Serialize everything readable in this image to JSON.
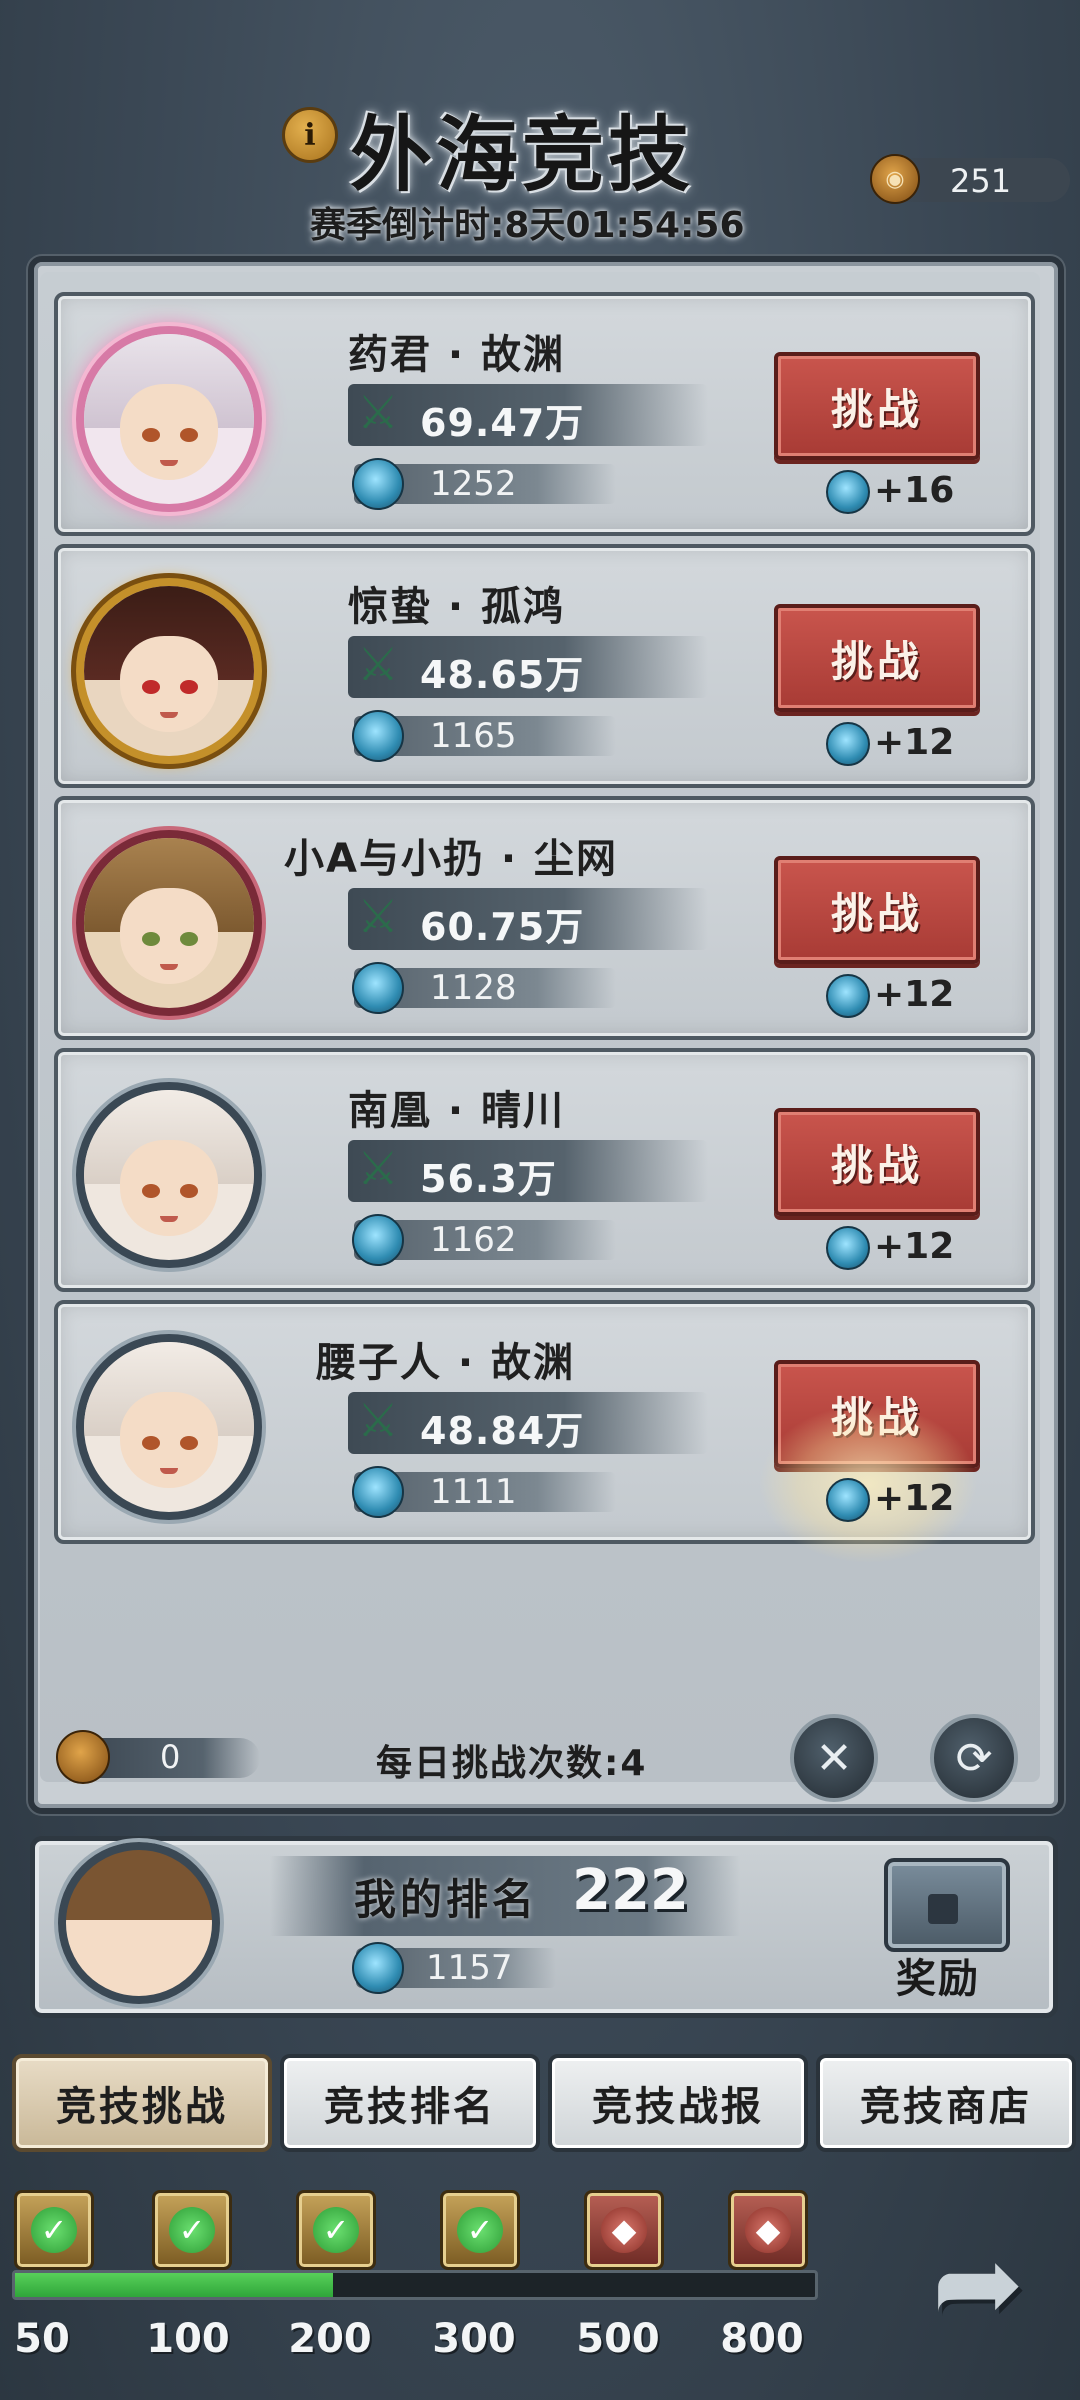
{
  "header": {
    "title": "外海竞技",
    "countdown": "赛季倒计时:8天01:54:56",
    "currency_value": "251",
    "info_icon": "info-icon",
    "currency_icon": "token-icon"
  },
  "opponents": [
    {
      "name": "药君 · 故渊",
      "power": "69.47万",
      "score": "1252",
      "gain": "+16",
      "button": "挑战"
    },
    {
      "name": "惊蛰 · 孤鸿",
      "power": "48.65万",
      "score": "1165",
      "gain": "+12",
      "button": "挑战"
    },
    {
      "name": "小A与小扔 · 尘网",
      "power": "60.75万",
      "score": "1128",
      "gain": "+12",
      "button": "挑战"
    },
    {
      "name": "南凰 · 晴川",
      "power": "56.3万",
      "score": "1162",
      "gain": "+12",
      "button": "挑战"
    },
    {
      "name": "腰子人 · 故渊",
      "power": "48.84万",
      "score": "1111",
      "gain": "+12",
      "button": "挑战"
    }
  ],
  "board_footer": {
    "ticket_value": "0",
    "daily_challenges": "每日挑战次数:4"
  },
  "my_rank": {
    "label": "我的排名",
    "rank": "222",
    "score": "1157",
    "reward_label": "奖励"
  },
  "tabs": [
    {
      "label": "竞技挑战",
      "active": true
    },
    {
      "label": "竞技排名",
      "active": false
    },
    {
      "label": "竞技战报",
      "active": false
    },
    {
      "label": "竞技商店",
      "active": false
    }
  ],
  "milestones": [
    {
      "label": "50",
      "claimed": true
    },
    {
      "label": "100",
      "claimed": true
    },
    {
      "label": "200",
      "claimed": true
    },
    {
      "label": "300",
      "claimed": true
    },
    {
      "label": "500",
      "claimed": false
    },
    {
      "label": "800",
      "claimed": false
    }
  ],
  "progress_fraction": 0.4,
  "colors": {
    "challenge_button": "#b8453e",
    "progress": "#3fbf45",
    "panel": "#c9cfd4"
  }
}
